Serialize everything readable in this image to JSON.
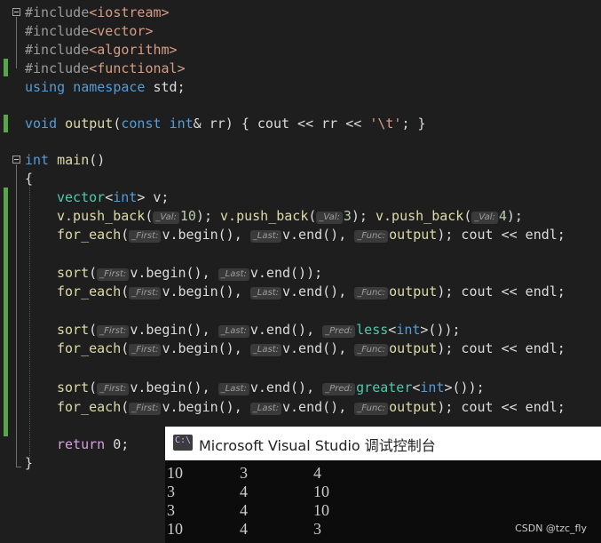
{
  "editor": {
    "lines": {
      "inc1": {
        "pre": "#include",
        "arg": "<iostream>"
      },
      "inc2": {
        "pre": "#include",
        "arg": "<vector>"
      },
      "inc3": {
        "pre": "#include",
        "arg": "<algorithm>"
      },
      "inc4": {
        "pre": "#include",
        "arg": "<functional>"
      },
      "using": {
        "kw1": "using",
        "kw2": "namespace",
        "rest": " std;"
      },
      "output": {
        "kw_void": "void",
        "fn_name": "output",
        "p1": "(",
        "kw_const": "const",
        "kw_int": "int",
        "amp": "&",
        "p2": " rr) { cout << rr << ",
        "str": "'\\t'",
        "p3": "; }"
      },
      "main": {
        "kw_int": "int",
        "fn_main": "main",
        "p": "()"
      },
      "brace_open": "{",
      "decl": {
        "ty_vector": "vector",
        "lt": "<",
        "kw_int": "int",
        "rest": "> v;"
      },
      "push": {
        "call": "v.push_back",
        "hint": "_Val:",
        "seg1_open": "(",
        "arg1": "10",
        "seg1_close": ");",
        "arg2": "3",
        "arg3": "4",
        "seg_close": ");"
      },
      "foreach": {
        "call": "for_each",
        "hint_first": "_First:",
        "hint_last": "_Last:",
        "hint_func": "_Func:",
        "a1": "v.begin(), ",
        "a2": "v.end(), ",
        "a3": "output",
        "tail": "); cout << endl;"
      },
      "sort": {
        "call": "sort",
        "a1": "v.begin(), ",
        "a2_end": "v.end());",
        "a2": "v.end(), ",
        "hint_pred": "_Pred:",
        "less": "less",
        "greater": "greater",
        "tpl_open": "<",
        "kw_int": "int",
        "tpl_close": ">());"
      },
      "ret": {
        "kw": "return",
        "val": " 0;"
      },
      "brace_close": "}"
    }
  },
  "console": {
    "title": "Microsoft Visual Studio 调试控制台",
    "icon": "console-app-icon",
    "icon_text": "C:\\",
    "rows": [
      [
        "10",
        "3",
        "4"
      ],
      [
        "3",
        "4",
        "10"
      ],
      [
        "3",
        "4",
        "10"
      ],
      [
        "10",
        "4",
        "3"
      ]
    ]
  },
  "watermark": "CSDN @tzc_fly"
}
